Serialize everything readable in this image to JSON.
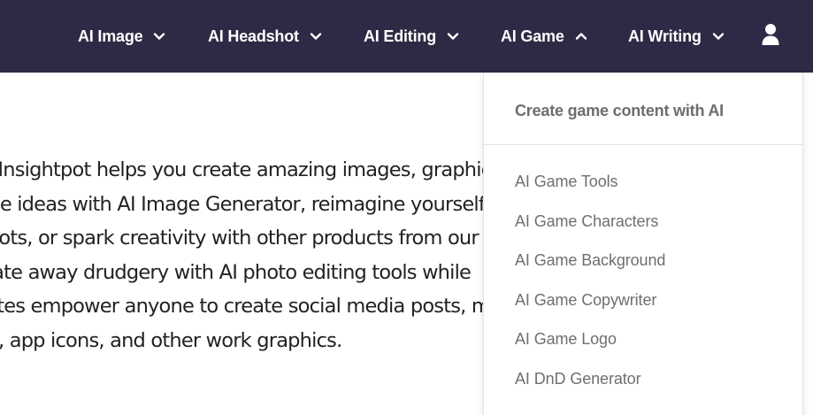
{
  "nav": {
    "items": [
      {
        "label": "AI Image",
        "expanded": false
      },
      {
        "label": "AI Headshot",
        "expanded": false
      },
      {
        "label": "AI Editing",
        "expanded": false
      },
      {
        "label": "AI Game",
        "expanded": true
      },
      {
        "label": "AI Writing",
        "expanded": false
      }
    ],
    "user_icon": "user-icon"
  },
  "body": {
    "lines": [
      "Fotor's Insightpot helps you create amazing images, graphics, and writ",
      "Visualize ideas with AI Image Generator, reimagine yourself",
      "headshots, or spark creativity with other products from our",
      "Automate away drudgery with AI photo editing tools while",
      "Templates empower anyone to create social media posts, m",
      "images, app icons, and other work graphics."
    ]
  },
  "dropdown": {
    "heading": "Create game content with AI",
    "items": [
      "AI Game Tools",
      "AI Game Characters",
      "AI Game Background",
      "AI Game Copywriter",
      "AI Game Logo",
      "AI DnD Generator"
    ]
  },
  "colors": {
    "nav_bg": "#2e2944",
    "nav_text": "#ffffff",
    "dropdown_text": "#6f6f6f"
  }
}
